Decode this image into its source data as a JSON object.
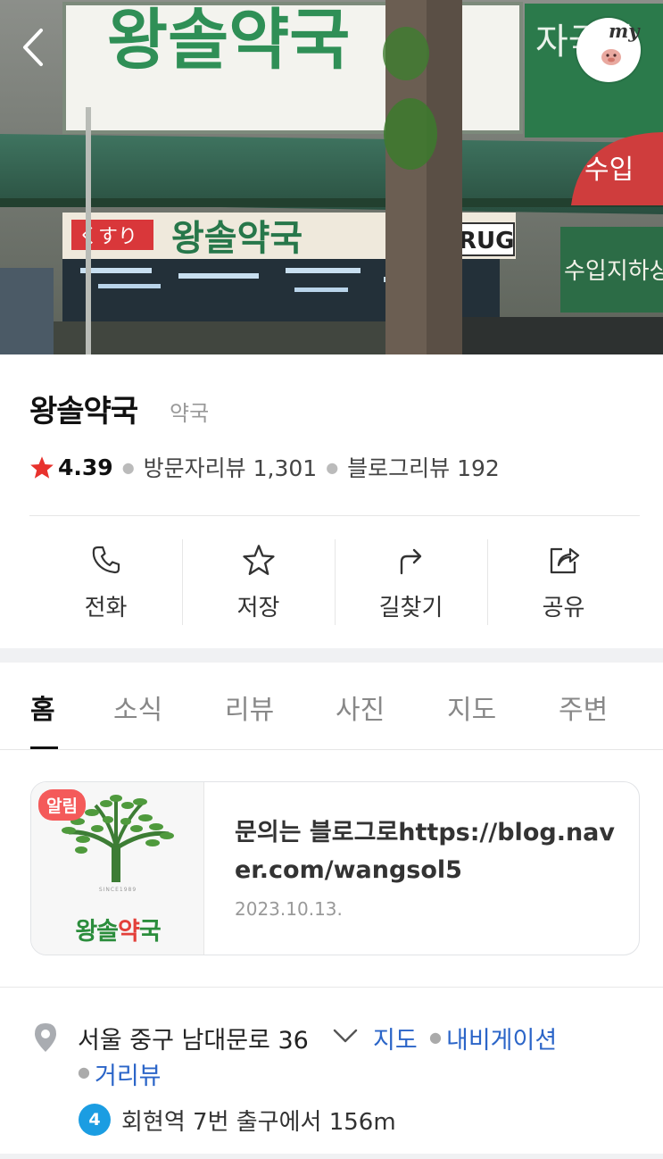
{
  "hero": {
    "photo_alt": "왕솔약국 storefront photo",
    "sign_top_text": "왕솔약국",
    "sign_low_kana": "くすり",
    "sign_low_text": "왕솔약국",
    "sign_drug": "RUG",
    "sign_side_text": "수입지하상",
    "sign_round_text": "수입"
  },
  "nav": {
    "back_icon": "chevron-left-icon",
    "my_label": "my"
  },
  "place": {
    "name": "왕솔약국",
    "category": "약국",
    "rating": "4.39",
    "visitor_review": "방문자리뷰 1,301",
    "blog_review": "블로그리뷰 192"
  },
  "actions": [
    {
      "label": "전화",
      "icon": "phone-icon"
    },
    {
      "label": "저장",
      "icon": "star-outline-icon"
    },
    {
      "label": "길찾기",
      "icon": "directions-icon"
    },
    {
      "label": "공유",
      "icon": "share-icon"
    }
  ],
  "tabs": [
    "홈",
    "소식",
    "리뷰",
    "사진",
    "지도",
    "주변"
  ],
  "active_tab": "홈",
  "notice": {
    "badge": "알림",
    "logo_since": "SINCE1989",
    "logo_text_a": "왕솔",
    "logo_text_b": "약",
    "logo_text_c": "국",
    "title": "문의는 블로그로https://blog.naver.com/wangsol5",
    "date": "2023.10.13."
  },
  "address": {
    "text": "서울 중구 남대문로 36",
    "link_map": "지도",
    "link_nav": "내비게이션",
    "link_street": "거리뷰",
    "subway_line": "4",
    "subway_text": "회현역 7번 출구에서 156m"
  },
  "colors": {
    "accent_blue": "#2b65c8",
    "star_red": "#e8322d",
    "badge_red": "#f45a5a",
    "subway_line4": "#1b9de2",
    "logo_green": "#2b8d3c"
  }
}
